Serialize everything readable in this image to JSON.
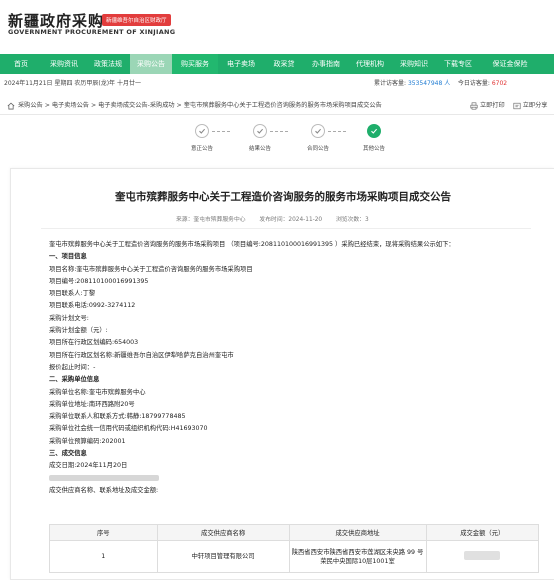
{
  "header": {
    "logo_cn": "新疆政府采购",
    "logo_badge": "新疆维吾尔自治区财政厅",
    "logo_en": "GOVERNMENT PROCUREMENT OF XINJIANG"
  },
  "nav": [
    "首页",
    "采购资讯",
    "政策法规",
    "采购公告",
    "购买服务",
    "电子卖场",
    "政采贷",
    "办事指南",
    "代理机构",
    "采购知识",
    "下载专区",
    "保证金保险"
  ],
  "nav_active_index": 3,
  "infobar": {
    "date": "2024年11月21日 星期四 农历甲辰(龙)年 十月廿一",
    "total_visits_label": "累计访客量:",
    "total_visits": "353547948 人",
    "today_visits_label": "今日访客量:",
    "today_visits": "6702"
  },
  "breadcrumb": {
    "path": "采购公告 > 电子卖场公告 > 电子卖场成交公告-采购成功 > 奎屯市殡葬服务中心关于工程造价咨询服务的服务市场采购项目成交公告",
    "print_label": "立即打印",
    "share_label": "立即分享"
  },
  "steps": [
    "意正公告",
    "结果公告",
    "合同公告",
    "其他公告"
  ],
  "steps_done_index": 3,
  "article": {
    "title": "奎屯市殡葬服务中心关于工程造价咨询服务的服务市场采购项目成交公告",
    "source": "来源：奎屯市殡葬服务中心",
    "publish_time": "发布时间：2024-11-20",
    "views": "浏览次数：3",
    "lines": [
      {
        "text": "奎屯市殡葬服务中心关于工程造价咨询服务的服务市场采购项目 （项目编号:208110100016991395 ）采购已经结束，现将采购结果公示如下：",
        "sec": false
      },
      {
        "text": "一、项目信息",
        "sec": true
      },
      {
        "text": "项目名称:奎屯市殡葬服务中心关于工程造价咨询服务的服务市场采购项目",
        "sec": false
      },
      {
        "text": "项目编号:208110100016991395",
        "sec": false
      },
      {
        "text": "项目联系人:丁黎",
        "sec": false
      },
      {
        "text": "项目联系电话:0992-3274112",
        "sec": false
      },
      {
        "text": "采购计划文号:",
        "sec": false
      },
      {
        "text": "采购计划金额（元）:",
        "sec": false
      },
      {
        "text": "项目所在行政区划编码:654003",
        "sec": false
      },
      {
        "text": "项目所在行政区划名称:新疆维吾尔自治区伊犁哈萨克自治州奎屯市",
        "sec": false
      },
      {
        "text": "报价起止时间：-",
        "sec": false
      },
      {
        "text": "二、采购单位信息",
        "sec": true
      },
      {
        "text": "采购单位名称:奎屯市殡葬服务中心",
        "sec": false
      },
      {
        "text": "采购单位地址:南环西路附20号",
        "sec": false
      },
      {
        "text": "采购单位联系人和联系方式:韩静:18799778485",
        "sec": false
      },
      {
        "text": "采购单位社会统一信用代码或组织机构代码:H41693070",
        "sec": false
      },
      {
        "text": "采购单位预算编码:202001",
        "sec": false
      },
      {
        "text": "三、成交信息",
        "sec": true
      },
      {
        "text": "成交日期:2024年11月20日",
        "sec": false
      },
      {
        "text": "",
        "sec": false
      },
      {
        "text": "成交供应商名称、联系地址及成交金额:",
        "sec": false
      }
    ]
  },
  "table": {
    "headers": [
      "序号",
      "成交供应商名称",
      "成交供应商地址",
      "成交金额（元）"
    ],
    "rows": [
      {
        "no": "1",
        "name": "中轩项目管理有限公司",
        "address": "陕西省西安市陕西省西安市莲湖区未央路 99 号荣民中央国际10层1001室",
        "amount": ""
      }
    ]
  },
  "colors": {
    "nav_bg": "#1fae6b",
    "badge": "#e23d3d"
  }
}
